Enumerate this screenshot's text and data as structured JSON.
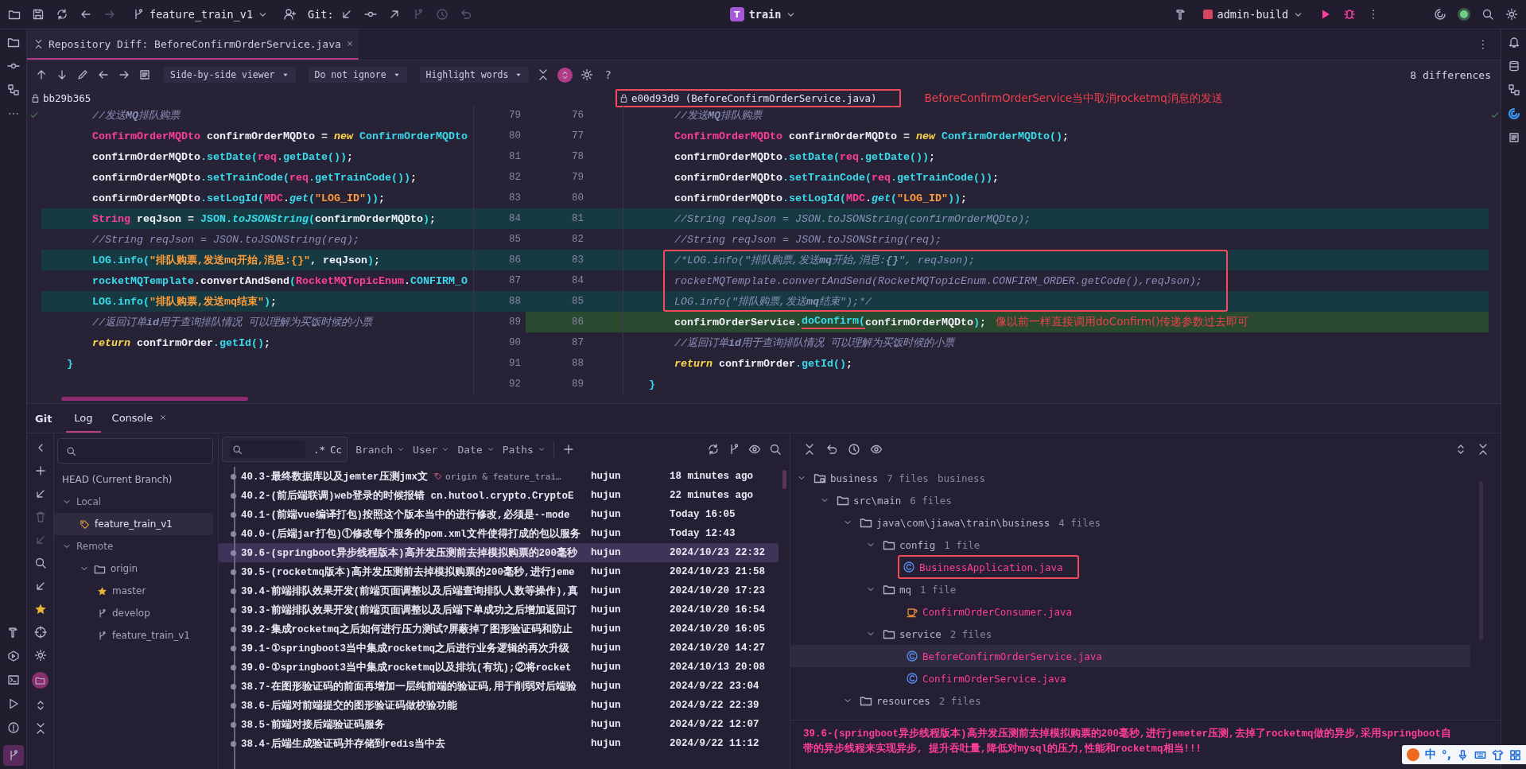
{
  "top_bar": {
    "branch": "feature_train_v1",
    "vcs_label": "Git:",
    "project_badge": "T",
    "project": "train",
    "run_config": "admin-build"
  },
  "editor_tabs": [
    {
      "label": "Repository Diff: BeforeConfirmOrderService.java",
      "selected": true
    }
  ],
  "diff_toolbar": {
    "viewer": "Side-by-side viewer",
    "whitespace": "Do not ignore",
    "highlight": "Highlight words",
    "sync_scroll": true,
    "help": "?",
    "differences": "8 differences"
  },
  "diff": {
    "left_revision": "bb29b365",
    "right_revision": "e00d93d9 (BeforeConfirmOrderService.java)",
    "right_revision_boxed": true,
    "annotation": "BeforeConfirmOrderService当中取消rocketmq消息的发送",
    "rows": [
      {
        "left_no": "79",
        "right_no": "76",
        "boxed": false,
        "left": [
          {
            "kind": "comment",
            "text": "        //发送"
          },
          {
            "kind": "comment_bold",
            "text": "MQ"
          },
          {
            "kind": "comment",
            "text": "排队购票"
          }
        ],
        "right": [
          {
            "kind": "comment",
            "text": "        //发送"
          },
          {
            "kind": "comment_bold",
            "text": "MQ"
          },
          {
            "kind": "comment",
            "text": "排队购票"
          }
        ]
      },
      {
        "left_no": "80",
        "right_no": "77",
        "boxed": false,
        "left": [
          {
            "kind": "type",
            "text": "        ConfirmOrderMQDto"
          },
          {
            "kind": "plain",
            "text": " confirmOrderMQDto = "
          },
          {
            "kind": "keyword",
            "text": "new"
          },
          {
            "kind": "method",
            "text": " ConfirmOrderMQDto"
          }
        ],
        "right": [
          {
            "kind": "type",
            "text": "        ConfirmOrderMQDto"
          },
          {
            "kind": "plain",
            "text": " confirmOrderMQDto = "
          },
          {
            "kind": "keyword",
            "text": "new"
          },
          {
            "kind": "method",
            "text": " ConfirmOrderMQDto()"
          },
          {
            "kind": "plain",
            "text": ";"
          }
        ]
      },
      {
        "left_no": "81",
        "right_no": "78",
        "boxed": false,
        "left": [
          {
            "kind": "plain",
            "text": "        confirmOrderMQDto"
          },
          {
            "kind": "method",
            "text": ".setDate("
          },
          {
            "kind": "type",
            "text": "req"
          },
          {
            "kind": "method",
            "text": ".getDate())"
          },
          {
            "kind": "plain",
            "text": ";"
          }
        ],
        "right": [
          {
            "kind": "plain",
            "text": "        confirmOrderMQDto"
          },
          {
            "kind": "method",
            "text": ".setDate("
          },
          {
            "kind": "type",
            "text": "req"
          },
          {
            "kind": "method",
            "text": ".getDate())"
          },
          {
            "kind": "plain",
            "text": ";"
          }
        ]
      },
      {
        "left_no": "82",
        "right_no": "79",
        "boxed": false,
        "left": [
          {
            "kind": "plain",
            "text": "        confirmOrderMQDto"
          },
          {
            "kind": "method",
            "text": ".setTrainCode("
          },
          {
            "kind": "type",
            "text": "req"
          },
          {
            "kind": "method",
            "text": ".getTrainCode())"
          },
          {
            "kind": "plain",
            "text": ";"
          }
        ],
        "right": [
          {
            "kind": "plain",
            "text": "        confirmOrderMQDto"
          },
          {
            "kind": "method",
            "text": ".setTrainCode("
          },
          {
            "kind": "type",
            "text": "req"
          },
          {
            "kind": "method",
            "text": ".getTrainCode())"
          },
          {
            "kind": "plain",
            "text": ";"
          }
        ]
      },
      {
        "left_no": "83",
        "right_no": "80",
        "boxed": false,
        "left": [
          {
            "kind": "plain",
            "text": "        confirmOrderMQDto"
          },
          {
            "kind": "method",
            "text": ".setLogId("
          },
          {
            "kind": "type",
            "text": "MDC"
          },
          {
            "kind": "plain",
            "text": "."
          },
          {
            "kind": "static",
            "text": "get"
          },
          {
            "kind": "method",
            "text": "("
          },
          {
            "kind": "string",
            "text": "\"LOG_ID\""
          },
          {
            "kind": "method",
            "text": "))"
          },
          {
            "kind": "plain",
            "text": ";"
          }
        ],
        "right": [
          {
            "kind": "plain",
            "text": "        confirmOrderMQDto"
          },
          {
            "kind": "method",
            "text": ".setLogId("
          },
          {
            "kind": "type",
            "text": "MDC"
          },
          {
            "kind": "plain",
            "text": "."
          },
          {
            "kind": "static",
            "text": "get"
          },
          {
            "kind": "method",
            "text": "("
          },
          {
            "kind": "string",
            "text": "\"LOG_ID\""
          },
          {
            "kind": "method",
            "text": "))"
          },
          {
            "kind": "plain",
            "text": ";"
          }
        ]
      },
      {
        "left_no": "84",
        "right_no": "81",
        "left_changed": true,
        "right_changed": true,
        "boxed": false,
        "left": [
          {
            "kind": "type",
            "text": "        String"
          },
          {
            "kind": "plain",
            "text": " reqJson = "
          },
          {
            "kind": "method",
            "text": "JSON."
          },
          {
            "kind": "static",
            "text": "toJSONString"
          },
          {
            "kind": "method",
            "text": "("
          },
          {
            "kind": "plain",
            "text": "confirmOrderMQDto"
          },
          {
            "kind": "method",
            "text": ")"
          },
          {
            "kind": "plain",
            "text": ";"
          }
        ],
        "right": [
          {
            "kind": "comment",
            "text": "        //String reqJson = JSON.toJSONString(confirmOrderMQDto);"
          }
        ]
      },
      {
        "left_no": "85",
        "right_no": "82",
        "boxed": false,
        "left": [
          {
            "kind": "comment",
            "text": "        //String reqJson = JSON.toJSONString(req);"
          }
        ],
        "right": [
          {
            "kind": "comment",
            "text": "        //String reqJson = JSON.toJSONString(req);"
          }
        ]
      },
      {
        "left_no": "86",
        "right_no": "83",
        "left_changed": true,
        "right_changed": true,
        "boxed": true,
        "left": [
          {
            "kind": "method",
            "text": "        LOG.info("
          },
          {
            "kind": "string",
            "text": "\"排队购票,发送mq开始,消息:{}\""
          },
          {
            "kind": "plain",
            "text": ", reqJson"
          },
          {
            "kind": "method",
            "text": ")"
          },
          {
            "kind": "plain",
            "text": ";"
          }
        ],
        "right": [
          {
            "kind": "comment",
            "text": "        /*LOG.info(\"排队购票,发送"
          },
          {
            "kind": "comment_bold",
            "text": "mq"
          },
          {
            "kind": "comment",
            "text": "开始,消息:"
          },
          {
            "kind": "comment_bold",
            "text": "{}"
          },
          {
            "kind": "comment",
            "text": "\", reqJson);"
          }
        ]
      },
      {
        "left_no": "87",
        "right_no": "84",
        "boxed": true,
        "left": [
          {
            "kind": "method",
            "text": "        rocketMQTemplate"
          },
          {
            "kind": "plain",
            "text": ".convertAndSend"
          },
          {
            "kind": "method",
            "text": "("
          },
          {
            "kind": "type",
            "text": "RocketMQTopicEnum"
          },
          {
            "kind": "plain",
            "text": "."
          },
          {
            "kind": "method",
            "text": "CONFIRM_O"
          }
        ],
        "right": [
          {
            "kind": "comment",
            "text": "        rocketMQTemplate.convertAndSend(RocketMQTopicEnum.CONFIRM_ORDER.getCode(),reqJson);"
          }
        ]
      },
      {
        "left_no": "88",
        "right_no": "85",
        "left_changed": true,
        "right_changed": true,
        "boxed": true,
        "left": [
          {
            "kind": "method",
            "text": "        LOG.info("
          },
          {
            "kind": "string",
            "text": "\"排队购票,发送mq结束\""
          },
          {
            "kind": "method",
            "text": ")"
          },
          {
            "kind": "plain",
            "text": ";"
          }
        ],
        "right": [
          {
            "kind": "comment",
            "text": "        LOG.info(\"排队购票,发送"
          },
          {
            "kind": "comment_bold",
            "text": "mq"
          },
          {
            "kind": "comment",
            "text": "结束\");*/"
          }
        ]
      },
      {
        "left_no": "89",
        "right_no": "86",
        "right_inserted": true,
        "boxed": false,
        "left": [
          {
            "kind": "comment",
            "text": "        //返回订单"
          },
          {
            "kind": "comment_bold",
            "text": "id"
          },
          {
            "kind": "comment",
            "text": "用于查询排队情况 可以理解为买饭时候的小票"
          }
        ],
        "right": [
          {
            "kind": "plain",
            "text": "        confirmOrderService."
          },
          {
            "kind": "method",
            "text": "doConfirm(",
            "underlined": true
          },
          {
            "kind": "plain",
            "text": "confirmOrderMQDto"
          },
          {
            "kind": "method",
            "text": ")"
          },
          {
            "kind": "plain",
            "text": ";"
          }
        ],
        "note": "像以前一样直接调用doConfirm()传递参数过去即可"
      },
      {
        "left_no": "90",
        "right_no": "87",
        "boxed": false,
        "left": [
          {
            "kind": "keyword",
            "text": "        return"
          },
          {
            "kind": "plain",
            "text": " confirmOrder"
          },
          {
            "kind": "method",
            "text": ".getId()"
          },
          {
            "kind": "plain",
            "text": ";"
          }
        ],
        "right": [
          {
            "kind": "comment",
            "text": "        //返回订单"
          },
          {
            "kind": "comment_bold",
            "text": "id"
          },
          {
            "kind": "comment",
            "text": "用于查询排队情况 可以理解为买饭时候的小票"
          }
        ]
      },
      {
        "left_no": "91",
        "right_no": "88",
        "boxed": false,
        "left": [
          {
            "kind": "method",
            "text": "    }"
          }
        ],
        "right": [
          {
            "kind": "keyword",
            "text": "        return"
          },
          {
            "kind": "plain",
            "text": " confirmOrder"
          },
          {
            "kind": "method",
            "text": ".getId()"
          },
          {
            "kind": "plain",
            "text": ";"
          }
        ]
      },
      {
        "left_no": "92",
        "right_no": "89",
        "boxed": false,
        "left": [],
        "right": [
          {
            "kind": "method",
            "text": "    }"
          }
        ]
      }
    ]
  },
  "bottom_panel": {
    "title": "Git",
    "tabs": [
      {
        "label": "Log",
        "selected": true,
        "closable": false
      },
      {
        "label": "Console",
        "selected": false,
        "closable": true
      }
    ]
  },
  "branches": [
    {
      "label": "HEAD (Current Branch)",
      "kind": "head",
      "selected": false
    },
    {
      "label": "Local",
      "kind": "group",
      "expanded": true,
      "selected": false,
      "children": [
        {
          "label": "feature_train_v1",
          "kind": "local_branch",
          "selected": true
        }
      ]
    },
    {
      "label": "Remote",
      "kind": "group",
      "expanded": true,
      "selected": false,
      "children": [
        {
          "label": "origin",
          "kind": "folder",
          "expanded": true,
          "selected": false,
          "children": [
            {
              "label": "master",
              "kind": "favorite",
              "selected": false
            },
            {
              "label": "develop",
              "kind": "branch",
              "selected": false
            },
            {
              "label": "feature_train_v1",
              "kind": "branch",
              "selected": false
            }
          ]
        }
      ]
    }
  ],
  "log_filters": {
    "regex": ".*",
    "case": "Cc",
    "filters": [
      "Branch",
      "User",
      "Date",
      "Paths"
    ]
  },
  "commits": [
    {
      "message": "40.3-最终数据库以及jemter压测jmx文",
      "ref": "origin & feature_trai…",
      "author": "hujun",
      "date": "18 minutes ago",
      "selected": false
    },
    {
      "message": "40.2-(前后端联调)web登录的时候报错 cn.hutool.crypto.CryptoE",
      "author": "hujun",
      "date": "22 minutes ago",
      "selected": false
    },
    {
      "message": "40.1-(前端vue编译打包)按照这个版本当中的进行修改,必须是--mode",
      "author": "hujun",
      "date": "Today 16:05",
      "selected": false
    },
    {
      "message": "40.0-(后端jar打包)①修改每个服务的pom.xml文件使得打成的包以服务",
      "author": "hujun",
      "date": "Today 12:43",
      "selected": false
    },
    {
      "message": "39.6-(springboot异步线程版本)高并发压测前去掉模拟购票的200毫秒",
      "author": "hujun",
      "date": "2024/10/23 22:32",
      "selected": true
    },
    {
      "message": "39.5-(rocketmq版本)高并发压测前去掉模拟购票的200毫秒,进行jeme",
      "author": "hujun",
      "date": "2024/10/23 21:58",
      "selected": false
    },
    {
      "message": "39.4-前端排队效果开发(前端页面调整以及后端查询排队人数等操作),真",
      "author": "hujun",
      "date": "2024/10/20 17:23",
      "selected": false
    },
    {
      "message": "39.3-前端排队效果开发(前端页面调整以及后端下单成功之后增加返回订",
      "author": "hujun",
      "date": "2024/10/20 16:54",
      "selected": false
    },
    {
      "message": "39.2-集成rocketmq之后如何进行压力测试?屏蔽掉了图形验证码和防止",
      "author": "hujun",
      "date": "2024/10/20 16:05",
      "selected": false
    },
    {
      "message": "39.1-①springboot3当中集成rocketmq之后进行业务逻辑的再次升级",
      "author": "hujun",
      "date": "2024/10/20 14:27",
      "selected": false
    },
    {
      "message": "39.0-①springboot3当中集成rocketmq以及排坑(有坑);②将rocket",
      "author": "hujun",
      "date": "2024/10/13 20:08",
      "selected": false
    },
    {
      "message": "38.7-在图形验证码的前面再增加一层纯前端的验证码,用于削弱对后端验",
      "author": "hujun",
      "date": "2024/9/22 23:04",
      "selected": false
    },
    {
      "message": "38.6-后端对前端提交的图形验证码做校验功能",
      "author": "hujun",
      "date": "2024/9/22 22:39",
      "selected": false
    },
    {
      "message": "38.5-前端对接后端验证码服务",
      "author": "hujun",
      "date": "2024/9/22 12:07",
      "selected": false
    },
    {
      "message": "38.4-后端生成验证码并存储到redis当中去",
      "author": "hujun",
      "date": "2024/9/22 11:12",
      "selected": false
    }
  ],
  "changes": {
    "tree": [
      {
        "name": "business",
        "count": "7 files",
        "module": "business",
        "kind": "module",
        "expanded": true,
        "selected": false,
        "boxed": false,
        "children": [
          {
            "name": "src\\main",
            "count": "6 files",
            "kind": "folder",
            "expanded": true,
            "selected": false,
            "boxed": false,
            "children": [
              {
                "name": "java\\com\\jiawa\\train\\business",
                "count": "4 files",
                "kind": "folder",
                "expanded": true,
                "selected": false,
                "boxed": false,
                "children": [
                  {
                    "name": "config",
                    "count": "1 file",
                    "kind": "folder",
                    "expanded": true,
                    "selected": false,
                    "boxed": false,
                    "children": [
                      {
                        "name": "BusinessApplication.java",
                        "kind": "app_class",
                        "selected": false,
                        "boxed": true
                      }
                    ]
                  },
                  {
                    "name": "mq",
                    "count": "1 file",
                    "kind": "folder",
                    "expanded": true,
                    "selected": false,
                    "boxed": false,
                    "children": [
                      {
                        "name": "ConfirmOrderConsumer.java",
                        "kind": "consumer",
                        "selected": false,
                        "boxed": false
                      }
                    ]
                  },
                  {
                    "name": "service",
                    "count": "2 files",
                    "kind": "folder",
                    "expanded": true,
                    "selected": false,
                    "boxed": false,
                    "children": [
                      {
                        "name": "BeforeConfirmOrderService.java",
                        "kind": "class",
                        "selected": true,
                        "boxed": false
                      },
                      {
                        "name": "ConfirmOrderService.java",
                        "kind": "class",
                        "selected": false,
                        "boxed": false
                      }
                    ]
                  }
                ]
              },
              {
                "name": "resources",
                "count": "2 files",
                "kind": "folder",
                "expanded": true,
                "selected": false,
                "boxed": false
              }
            ]
          }
        ]
      }
    ],
    "commit_message": "39.6-(springboot异步线程版本)高并发压测前去掉模拟购票的200毫秒,进行jemeter压测,去掉了rocketmq做的异步,采用springboot自带的异步线程来实现异步, 提升吞吐量,降低对mysql的压力,性能和rocketmq相当!!!"
  },
  "ime_bar": {
    "mode": "中",
    "punctuation": "°,"
  }
}
